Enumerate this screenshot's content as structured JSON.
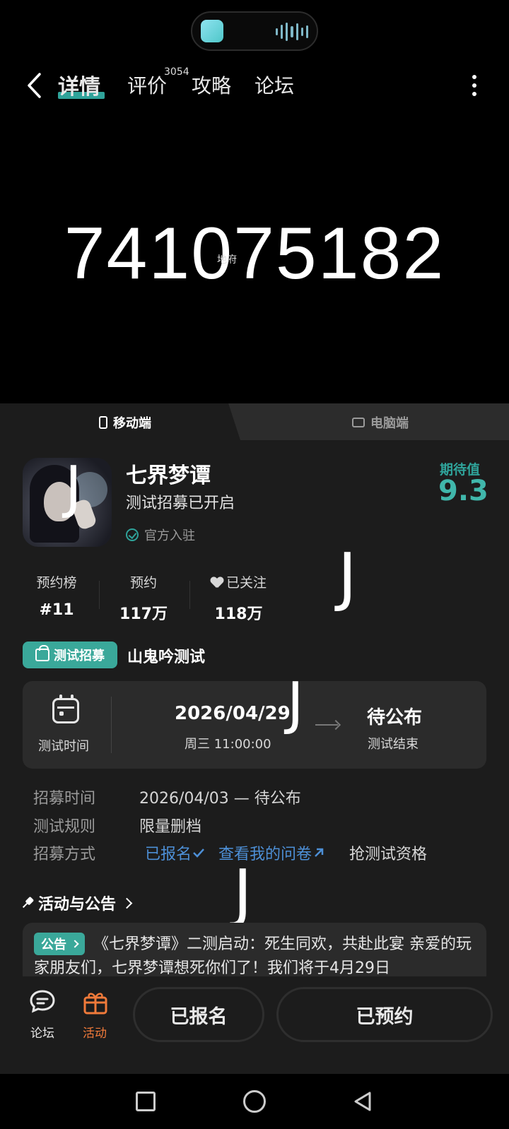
{
  "status_island": {
    "app_icon": "game-center-icon",
    "indicator": "audio-wave-icon"
  },
  "nav": {
    "tabs": [
      {
        "label": "详情",
        "active": true
      },
      {
        "label": "评价",
        "badge": "3054"
      },
      {
        "label": "攻略"
      },
      {
        "label": "论坛"
      }
    ]
  },
  "media": {
    "number_text": "741075182",
    "watermark": "地府"
  },
  "platform": {
    "mobile": "移动端",
    "pc": "电脑端"
  },
  "game": {
    "title": "七界梦谭",
    "subtitle": "测试招募已开启",
    "verified": "官方入驻",
    "expect_label": "期待值",
    "expect_value": "9.3"
  },
  "stats": [
    {
      "label": "预约榜",
      "value": "#11"
    },
    {
      "label": "预约",
      "value": "117万"
    },
    {
      "label": "已关注",
      "value": "118万"
    }
  ],
  "scribbles": {
    "mark": "J"
  },
  "test": {
    "tag": "测试招募",
    "name": "山鬼吟测试",
    "card_label": "测试时间",
    "start_date": "2026/04/29",
    "start_time": "周三  11:00:00",
    "end_label": "待公布",
    "end_sub": "测试结束"
  },
  "details": [
    {
      "label": "招募时间",
      "value": "2026/04/03 — 待公布"
    },
    {
      "label": "测试规则",
      "value": "限量删档"
    },
    {
      "label": "招募方式",
      "signed": "已报名",
      "questionnaire": "查看我的问卷",
      "extra": "抢测试资格"
    }
  ],
  "notice_section": {
    "title": "活动与公告",
    "tag": "公告",
    "text": "《七界梦谭》二测启动：死生同欢，共赴此宴 亲爱的玩家朋友们，七界梦谭想死你们了！我们将于4月29日"
  },
  "bottom": {
    "forum": "论坛",
    "activity": "活动",
    "signed_button": "已报名",
    "reserved_button": "已预约"
  },
  "colors": {
    "accent": "#3aa89a",
    "link": "#4d8fd6",
    "activity": "#f07a3a"
  }
}
